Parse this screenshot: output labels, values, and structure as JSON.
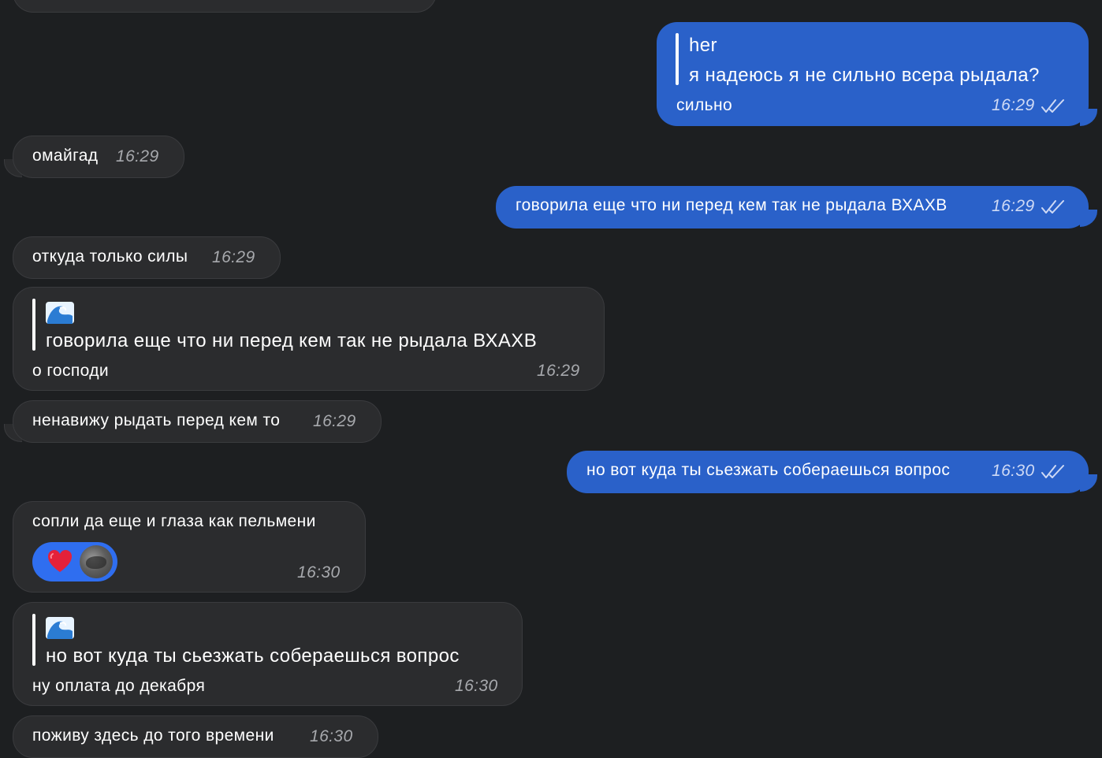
{
  "colors": {
    "background": "#1d1f21",
    "incoming": "#2b2c2e",
    "outgoing": "#2a61c9",
    "reaction": "#2f6ef0"
  },
  "messages": {
    "m1": {
      "reply_name": "her",
      "reply_text": "я надеюсь я не сильно всера рыдала?",
      "text": "сильно",
      "time": "16:29",
      "status": "double-check-icon"
    },
    "m2": {
      "text": "омайгад",
      "time": "16:29"
    },
    "m3": {
      "text": "говорила еще что ни перед кем так не рыдала ВХАХВ",
      "time": "16:29",
      "status": "double-check-icon"
    },
    "m4": {
      "text": "откуда только силы",
      "time": "16:29"
    },
    "m5": {
      "reply_icon": "wave-emoji-icon",
      "reply_text": "говорила еще что ни перед кем так не рыдала ВХАХВ",
      "text": "о господи",
      "time": "16:29"
    },
    "m6": {
      "text": "ненавижу рыдать перед кем то",
      "time": "16:29"
    },
    "m7": {
      "text": "но вот куда ты сьезжать собераешься вопрос",
      "time": "16:30",
      "status": "double-check-icon"
    },
    "m8": {
      "text": "сопли да еще и глаза как пельмени",
      "time": "16:30",
      "reaction": "heart-icon"
    },
    "m9": {
      "reply_icon": "wave-emoji-icon",
      "reply_text": "но вот куда ты сьезжать собераешься вопрос",
      "text": "ну оплата до декабря",
      "time": "16:30"
    },
    "m10": {
      "text": "поживу здесь до того времени",
      "time": "16:30"
    }
  }
}
